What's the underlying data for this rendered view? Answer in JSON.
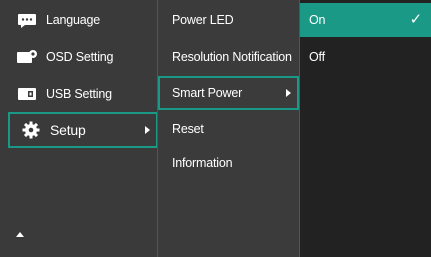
{
  "main_menu": {
    "items": [
      {
        "label": "Language",
        "icon": "language-icon"
      },
      {
        "label": "OSD Setting",
        "icon": "osd-setting-icon"
      },
      {
        "label": "USB Setting",
        "icon": "usb-setting-icon"
      },
      {
        "label": "Setup",
        "icon": "gear-icon"
      }
    ],
    "selected": "Setup"
  },
  "sub_menu": {
    "items": [
      "Power LED",
      "Resolution Notification",
      "Smart Power",
      "Reset",
      "Information"
    ],
    "selected": "Smart Power"
  },
  "options": {
    "items": [
      "On",
      "Off"
    ],
    "selected": "On"
  },
  "colors": {
    "accent": "#1a9a86",
    "panel_bg": "#3a3a3a",
    "options_bg": "#222222"
  }
}
